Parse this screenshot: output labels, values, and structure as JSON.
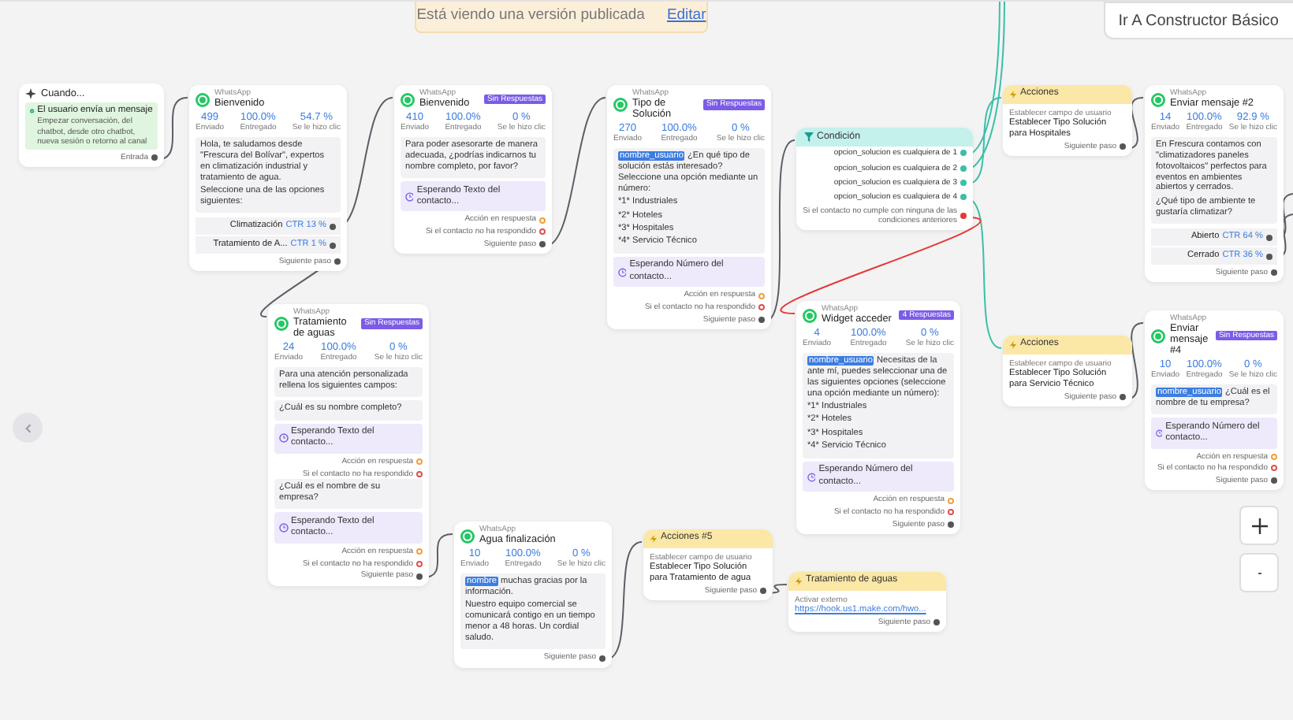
{
  "banner": {
    "text": "Está viendo una versión publicada",
    "link": "Editar"
  },
  "builder_button": "Ir A Constructor Básico",
  "nodes": [
    {
      "kind": "trigger",
      "title": "Cuando...",
      "event": "El usuario envía un mensaje",
      "detail": "Empezar conversación, del chatbot, desde otro chatbot, nueva sesión o retorno al canal",
      "output": "Entrada"
    },
    {
      "kind": "message",
      "channel": "WhatsApp",
      "title": "Bienvenido",
      "stats": [
        {
          "value": "499",
          "label": "Enviado"
        },
        {
          "value": "100.0%",
          "label": "Entregado"
        },
        {
          "value": "54.7 %",
          "label": "Se le hizo clic"
        }
      ],
      "items": [
        {
          "kind": "text",
          "paragraphs": [
            "Hola, te saludamos desde \"Frescura del Bolívar\", expertos en climatización industrial y tratamiento de agua.",
            "Seleccione una de las opciones siguientes:"
          ]
        },
        {
          "kind": "button",
          "label": "Climatización",
          "ctr": "CTR 13 %"
        },
        {
          "kind": "button",
          "label": "Tratamiento de A...",
          "ctr": "CTR 1 %"
        },
        {
          "kind": "next",
          "label": "Siguiente paso"
        }
      ]
    },
    {
      "kind": "message",
      "channel": "WhatsApp",
      "title": "Bienvenido",
      "badge": "Sin Respuestas",
      "stats": [
        {
          "value": "410",
          "label": "Enviado"
        },
        {
          "value": "100.0%",
          "label": "Entregado"
        },
        {
          "value": "0 %",
          "label": "Se le hizo clic"
        }
      ],
      "items": [
        {
          "kind": "text",
          "paragraphs": [
            "Para poder asesorarte de manera adecuada, ¿podrías indicarnos tu nombre completo, por favor?"
          ]
        },
        {
          "kind": "wait",
          "label": "Esperando Texto del contacto..."
        },
        {
          "kind": "reply",
          "label": "Acción en respuesta"
        },
        {
          "kind": "timeout",
          "label": "Si el contacto no ha respondido"
        },
        {
          "kind": "next",
          "label": "Siguiente paso"
        }
      ]
    },
    {
      "kind": "message",
      "channel": "WhatsApp",
      "title": "Tipo de Solución",
      "badge": "Sin Respuestas",
      "stats": [
        {
          "value": "270",
          "label": "Enviado"
        },
        {
          "value": "100.0%",
          "label": "Entregado"
        },
        {
          "value": "0 %",
          "label": "Se le hizo clic"
        }
      ],
      "items": [
        {
          "kind": "text",
          "variable": "nombre_usuario",
          "paragraphs": [
            "¿En qué tipo de solución estás interesado? Seleccione una opción mediante un número:",
            "*1* Industriales",
            "*2* Hoteles",
            "*3* Hospitales",
            "*4* Servicio Técnico"
          ]
        },
        {
          "kind": "wait",
          "label": "Esperando Número del contacto..."
        },
        {
          "kind": "reply",
          "label": "Acción en respuesta"
        },
        {
          "kind": "timeout",
          "label": "Si el contacto no ha respondido"
        },
        {
          "kind": "next",
          "label": "Siguiente paso"
        }
      ]
    },
    {
      "kind": "condition",
      "title": "Condición",
      "items": [
        {
          "kind": "rule",
          "label": "opcion_solucion es cualquiera de 1"
        },
        {
          "kind": "rule",
          "label": "opcion_solucion es cualquiera de 2"
        },
        {
          "kind": "rule",
          "label": "opcion_solucion es cualquiera de 3"
        },
        {
          "kind": "rule",
          "label": "opcion_solucion es cualquiera de 4"
        },
        {
          "kind": "timeout",
          "label": "Si el contacto no cumple con ninguna de las condiciones anteriores"
        }
      ]
    },
    {
      "kind": "message",
      "channel": "WhatsApp",
      "title": "Widget acceder",
      "badge": "4 Respuestas",
      "stats": [
        {
          "value": "4",
          "label": "Enviado"
        },
        {
          "value": "100.0%",
          "label": "Entregado"
        },
        {
          "value": "0 %",
          "label": "Se le hizo clic"
        }
      ],
      "items": [
        {
          "kind": "text",
          "variable": "nombre_usuario",
          "paragraphs": [
            "Necesitas de la ante mí, puedes seleccionar una de las siguientes opciones (seleccione una opción mediante un número):",
            "*1* Industriales",
            "*2* Hoteles",
            "*3* Hospitales",
            "*4* Servicio Técnico"
          ]
        },
        {
          "kind": "wait",
          "label": "Esperando Número del contacto..."
        },
        {
          "kind": "reply",
          "label": "Acción en respuesta"
        },
        {
          "kind": "timeout",
          "label": "Si el contacto no ha respondido"
        },
        {
          "kind": "next",
          "label": "Siguiente paso"
        }
      ]
    },
    {
      "kind": "action",
      "title": "Acciones",
      "field": "Establecer campo de usuario",
      "action": "Establecer Tipo Solución para Hospitales",
      "output": "Siguiente paso"
    },
    {
      "kind": "message",
      "channel": "WhatsApp",
      "title": "Enviar mensaje #2",
      "stats": [
        {
          "value": "14",
          "label": "Enviado"
        },
        {
          "value": "100.0%",
          "label": "Entregado"
        },
        {
          "value": "92.9 %",
          "label": "Se le hizo clic"
        }
      ],
      "items": [
        {
          "kind": "text",
          "paragraphs": [
            "En Frescura contamos con \"climatizadores paneles fotovoltaicos\" perfectos para eventos en ambientes abiertos y cerrados.",
            "¿Qué tipo de ambiente te gustaría climatizar?"
          ]
        },
        {
          "kind": "button",
          "label": "Abierto",
          "ctr": "CTR 64 %"
        },
        {
          "kind": "button",
          "label": "Cerrado",
          "ctr": "CTR 36 %"
        },
        {
          "kind": "next",
          "label": "Siguiente paso"
        }
      ]
    },
    {
      "kind": "action",
      "title": "Acciones",
      "field": "Establecer campo de usuario",
      "action": "Establecer Tipo Solución para Servicio Técnico",
      "output": "Siguiente paso"
    },
    {
      "kind": "message",
      "channel": "WhatsApp",
      "title": "Enviar mensaje #4",
      "badge": "Sin Respuestas",
      "stats": [
        {
          "value": "10",
          "label": "Enviado"
        },
        {
          "value": "100.0%",
          "label": "Entregado"
        },
        {
          "value": "0 %",
          "label": "Se le hizo clic"
        }
      ],
      "items": [
        {
          "kind": "text",
          "variable": "nombre_usuario",
          "paragraphs": [
            "¿Cuál es el nombre de tu empresa?"
          ]
        },
        {
          "kind": "wait",
          "label": "Esperando Número del contacto..."
        },
        {
          "kind": "reply",
          "label": "Acción en respuesta"
        },
        {
          "kind": "timeout",
          "label": "Si el contacto no ha respondido"
        },
        {
          "kind": "next",
          "label": "Siguiente paso"
        }
      ]
    },
    {
      "kind": "message",
      "channel": "WhatsApp",
      "title": "Tratamiento de aguas",
      "badge": "Sin Respuestas",
      "stats": [
        {
          "value": "24",
          "label": "Enviado"
        },
        {
          "value": "100.0%",
          "label": "Entregado"
        },
        {
          "value": "0 %",
          "label": "Se le hizo clic"
        }
      ],
      "items": [
        {
          "kind": "text",
          "paragraphs": [
            "Para una atención personalizada rellena los siguientes campos:"
          ]
        },
        {
          "kind": "text",
          "paragraphs": [
            "¿Cuál es su nombre completo?"
          ]
        },
        {
          "kind": "wait",
          "label": "Esperando Texto del contacto..."
        },
        {
          "kind": "reply",
          "label": "Acción en respuesta"
        },
        {
          "kind": "timeout",
          "label": "Si el contacto no ha respondido"
        },
        {
          "kind": "text",
          "paragraphs": [
            "¿Cuál es el nombre de su empresa?"
          ]
        },
        {
          "kind": "wait",
          "label": "Esperando Texto del contacto..."
        },
        {
          "kind": "reply",
          "label": "Acción en respuesta"
        },
        {
          "kind": "timeout",
          "label": "Si el contacto no ha respondido"
        },
        {
          "kind": "next",
          "label": "Siguiente paso"
        }
      ]
    },
    {
      "kind": "message",
      "channel": "WhatsApp",
      "title": "Agua finalización",
      "stats": [
        {
          "value": "10",
          "label": "Enviado"
        },
        {
          "value": "100.0%",
          "label": "Entregado"
        },
        {
          "value": "0 %",
          "label": "Se le hizo clic"
        }
      ],
      "items": [
        {
          "kind": "text",
          "variable": "nombre",
          "paragraphs": [
            "muchas gracias por la información.",
            "Nuestro equipo comercial se comunicará contigo en un tiempo menor a 48 horas. Un cordial saludo."
          ]
        },
        {
          "kind": "next",
          "label": "Siguiente paso"
        }
      ]
    },
    {
      "kind": "action",
      "title": "Acciones #5",
      "field": "Establecer campo de usuario",
      "action": "Establecer Tipo Solución para Tratamiento de agua",
      "output": "Siguiente paso"
    },
    {
      "kind": "webhook",
      "title": "Tratamiento de aguas",
      "field": "Activar externo",
      "action": "https://hook.us1.make.com/hwo...",
      "output": "Siguiente paso"
    }
  ]
}
